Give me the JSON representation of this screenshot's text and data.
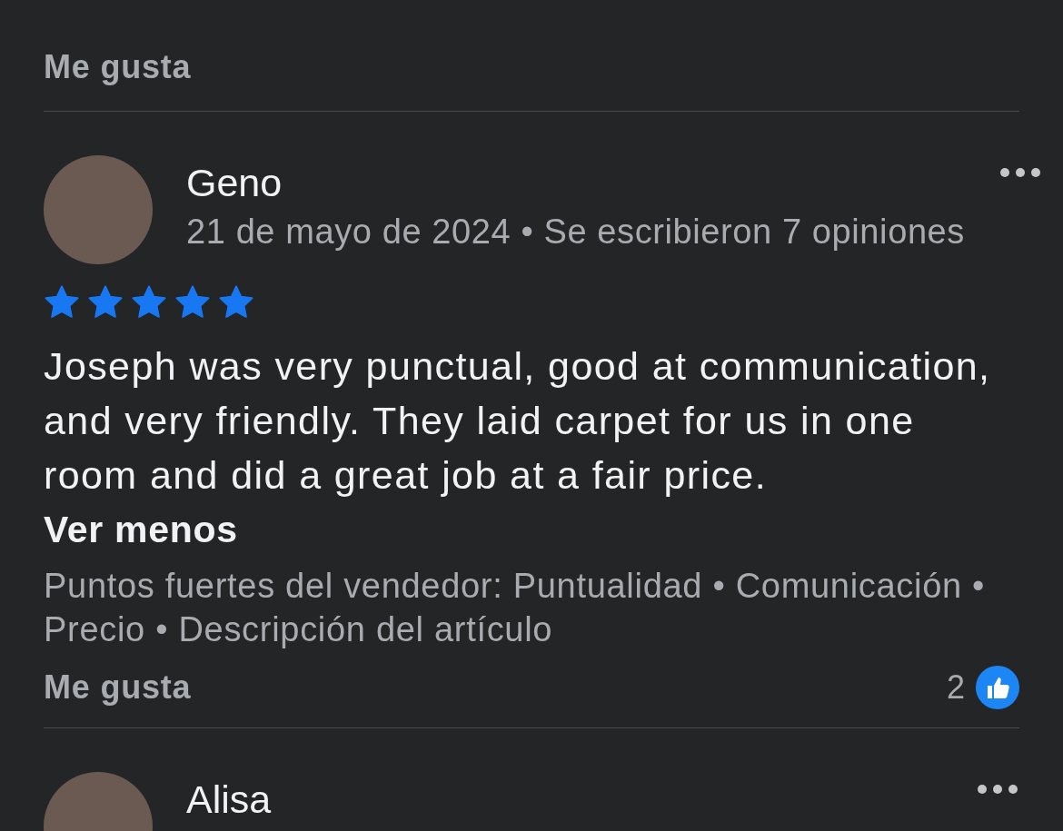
{
  "header": {
    "label": "Me gusta"
  },
  "reviews": [
    {
      "name": "Geno",
      "meta": "21 de mayo de 2024 • Se escribieron 7 opiniones",
      "stars": 5,
      "text": "Joseph was very punctual, good at communication, and very friendly.  They laid carpet for us in one room and did a great job at a fair price.",
      "toggle": "Ver menos",
      "strengths": "Puntos fuertes del vendedor: Puntualidad • Comunicación • Precio • Descripción del artículo",
      "like_label": "Me gusta",
      "like_count": "2"
    },
    {
      "name": "Alisa"
    }
  ]
}
